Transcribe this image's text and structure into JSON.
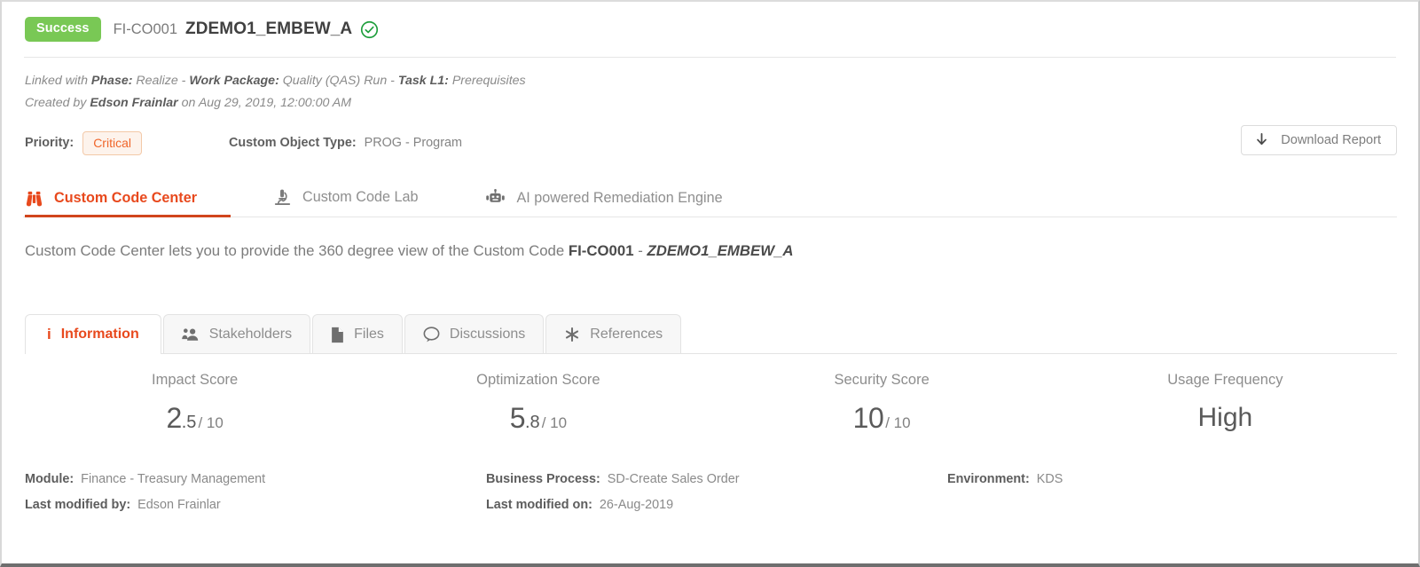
{
  "header": {
    "status_badge": "Success",
    "code": "FI-CO001",
    "name": "ZDEMO1_EMBEW_A",
    "verified_icon": "check-circle-icon"
  },
  "meta": {
    "linked_prefix": "Linked with ",
    "phase_label": "Phase:",
    "phase_value": " Realize - ",
    "work_package_label": "Work Package:",
    "work_package_value": " Quality (QAS) Run - ",
    "task_label": "Task L1:",
    "task_value": " Prerequisites",
    "created_prefix": "Created by ",
    "created_by": "Edson Frainlar",
    "created_suffix": " on Aug 29, 2019, 12:00:00 AM"
  },
  "attributes": {
    "priority_label": "Priority:",
    "priority_value": "Critical",
    "object_type_label": "Custom Object Type:",
    "object_type_value": "PROG - Program",
    "download_label": "Download Report",
    "download_icon": "download-arrow-icon"
  },
  "top_tabs": [
    {
      "label": "Custom Code Center",
      "icon": "binoculars-icon",
      "active": true
    },
    {
      "label": "Custom Code Lab",
      "icon": "microscope-icon",
      "active": false
    },
    {
      "label": "AI powered Remediation Engine",
      "icon": "robot-icon",
      "active": false
    }
  ],
  "description": {
    "prefix": "Custom Code Center lets you to provide the 360 degree view of the Custom Code ",
    "code": "FI-CO001",
    "separator": " - ",
    "name": "ZDEMO1_EMBEW_A"
  },
  "sub_tabs": [
    {
      "label": "Information",
      "icon": "info-icon",
      "active": true
    },
    {
      "label": "Stakeholders",
      "icon": "users-icon",
      "active": false
    },
    {
      "label": "Files",
      "icon": "file-icon",
      "active": false
    },
    {
      "label": "Discussions",
      "icon": "comment-icon",
      "active": false
    },
    {
      "label": "References",
      "icon": "asterisk-icon",
      "active": false
    }
  ],
  "scores": [
    {
      "label": "Impact Score",
      "int": "2",
      "dec": ".5",
      "out_of": "/ 10"
    },
    {
      "label": "Optimization Score",
      "int": "5",
      "dec": ".8",
      "out_of": "/ 10"
    },
    {
      "label": "Security Score",
      "int": "10",
      "dec": "",
      "out_of": "/ 10"
    },
    {
      "label": "Usage Frequency",
      "text": "High"
    }
  ],
  "details": {
    "module_label": "Module:",
    "module_value": "Finance - Treasury Management",
    "business_process_label": "Business Process:",
    "business_process_value": "SD-Create Sales Order",
    "environment_label": "Environment:",
    "environment_value": "KDS",
    "last_modified_by_label": "Last modified by:",
    "last_modified_by_value": "Edson Frainlar",
    "last_modified_on_label": "Last modified on:",
    "last_modified_on_value": "26-Aug-2019"
  },
  "colors": {
    "success_green": "#79c855",
    "accent_red": "#e8491d",
    "priority_orange": "#f0662b",
    "check_green": "#1e9e3c"
  }
}
